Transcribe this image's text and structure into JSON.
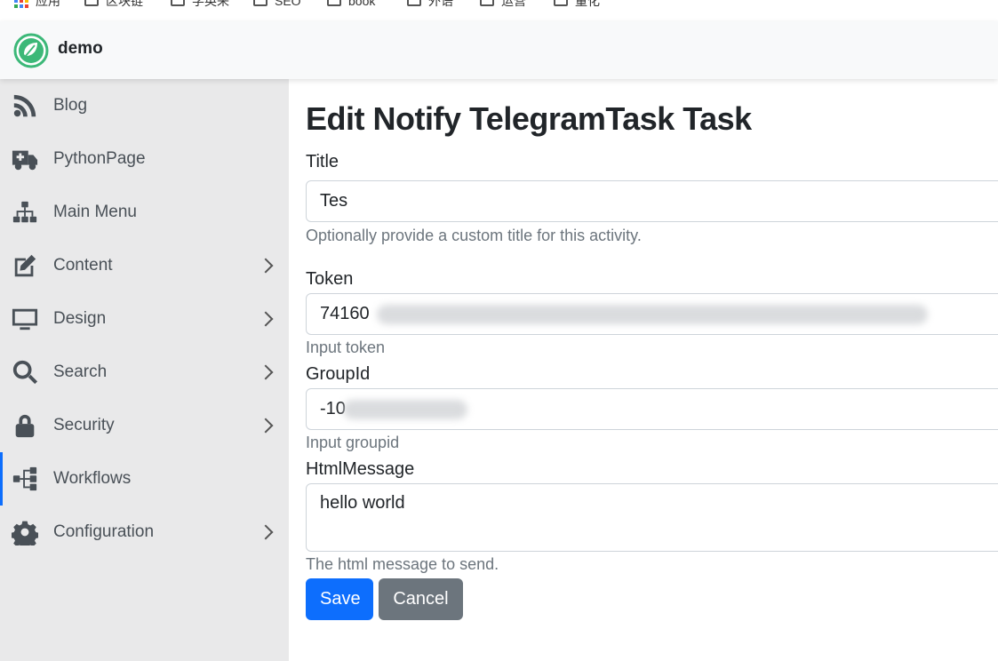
{
  "bookmarks": [
    {
      "label": "应用",
      "icon": "apps-icon"
    },
    {
      "label": "区块链",
      "icon": "folder-icon"
    },
    {
      "label": "学英来",
      "icon": "folder-icon"
    },
    {
      "label": "SEO",
      "icon": "folder-icon"
    },
    {
      "label": "book",
      "icon": "folder-icon"
    },
    {
      "label": "外语",
      "icon": "folder-icon"
    },
    {
      "label": "运营",
      "icon": "folder-icon"
    },
    {
      "label": "量化",
      "icon": "folder-icon"
    }
  ],
  "header": {
    "brand": "demo",
    "logo_color": "#3cb878"
  },
  "sidebar": {
    "items": [
      {
        "label": "Blog",
        "icon": "rss-icon",
        "has_children": false
      },
      {
        "label": "PythonPage",
        "icon": "truck-medical-icon",
        "has_children": false
      },
      {
        "label": "Main Menu",
        "icon": "sitemap-icon",
        "has_children": false
      },
      {
        "label": "Content",
        "icon": "edit-icon",
        "has_children": true
      },
      {
        "label": "Design",
        "icon": "monitor-icon",
        "has_children": true
      },
      {
        "label": "Search",
        "icon": "search-icon",
        "has_children": true
      },
      {
        "label": "Security",
        "icon": "lock-icon",
        "has_children": true
      },
      {
        "label": "Workflows",
        "icon": "workflow-icon",
        "has_children": false,
        "active": true
      },
      {
        "label": "Configuration",
        "icon": "gear-icon",
        "has_children": true
      }
    ]
  },
  "form": {
    "title": "Edit Notify TelegramTask Task",
    "fields": {
      "title": {
        "label": "Title",
        "value": "Tes",
        "help": "Optionally provide a custom title for this activity."
      },
      "token": {
        "label": "Token",
        "value": "74160",
        "help": "Input token"
      },
      "groupid": {
        "label": "GroupId",
        "value": "-10",
        "help": "Input groupid"
      },
      "htmlmessage": {
        "label": "HtmlMessage",
        "value": "hello world",
        "help": "The html message to send."
      }
    },
    "save_label": "Save",
    "cancel_label": "Cancel"
  },
  "colors": {
    "primary": "#0d6efd",
    "secondary": "#6c757d",
    "sidebar_bg": "#e9e9ea",
    "active_indicator": "#0d6efd"
  }
}
